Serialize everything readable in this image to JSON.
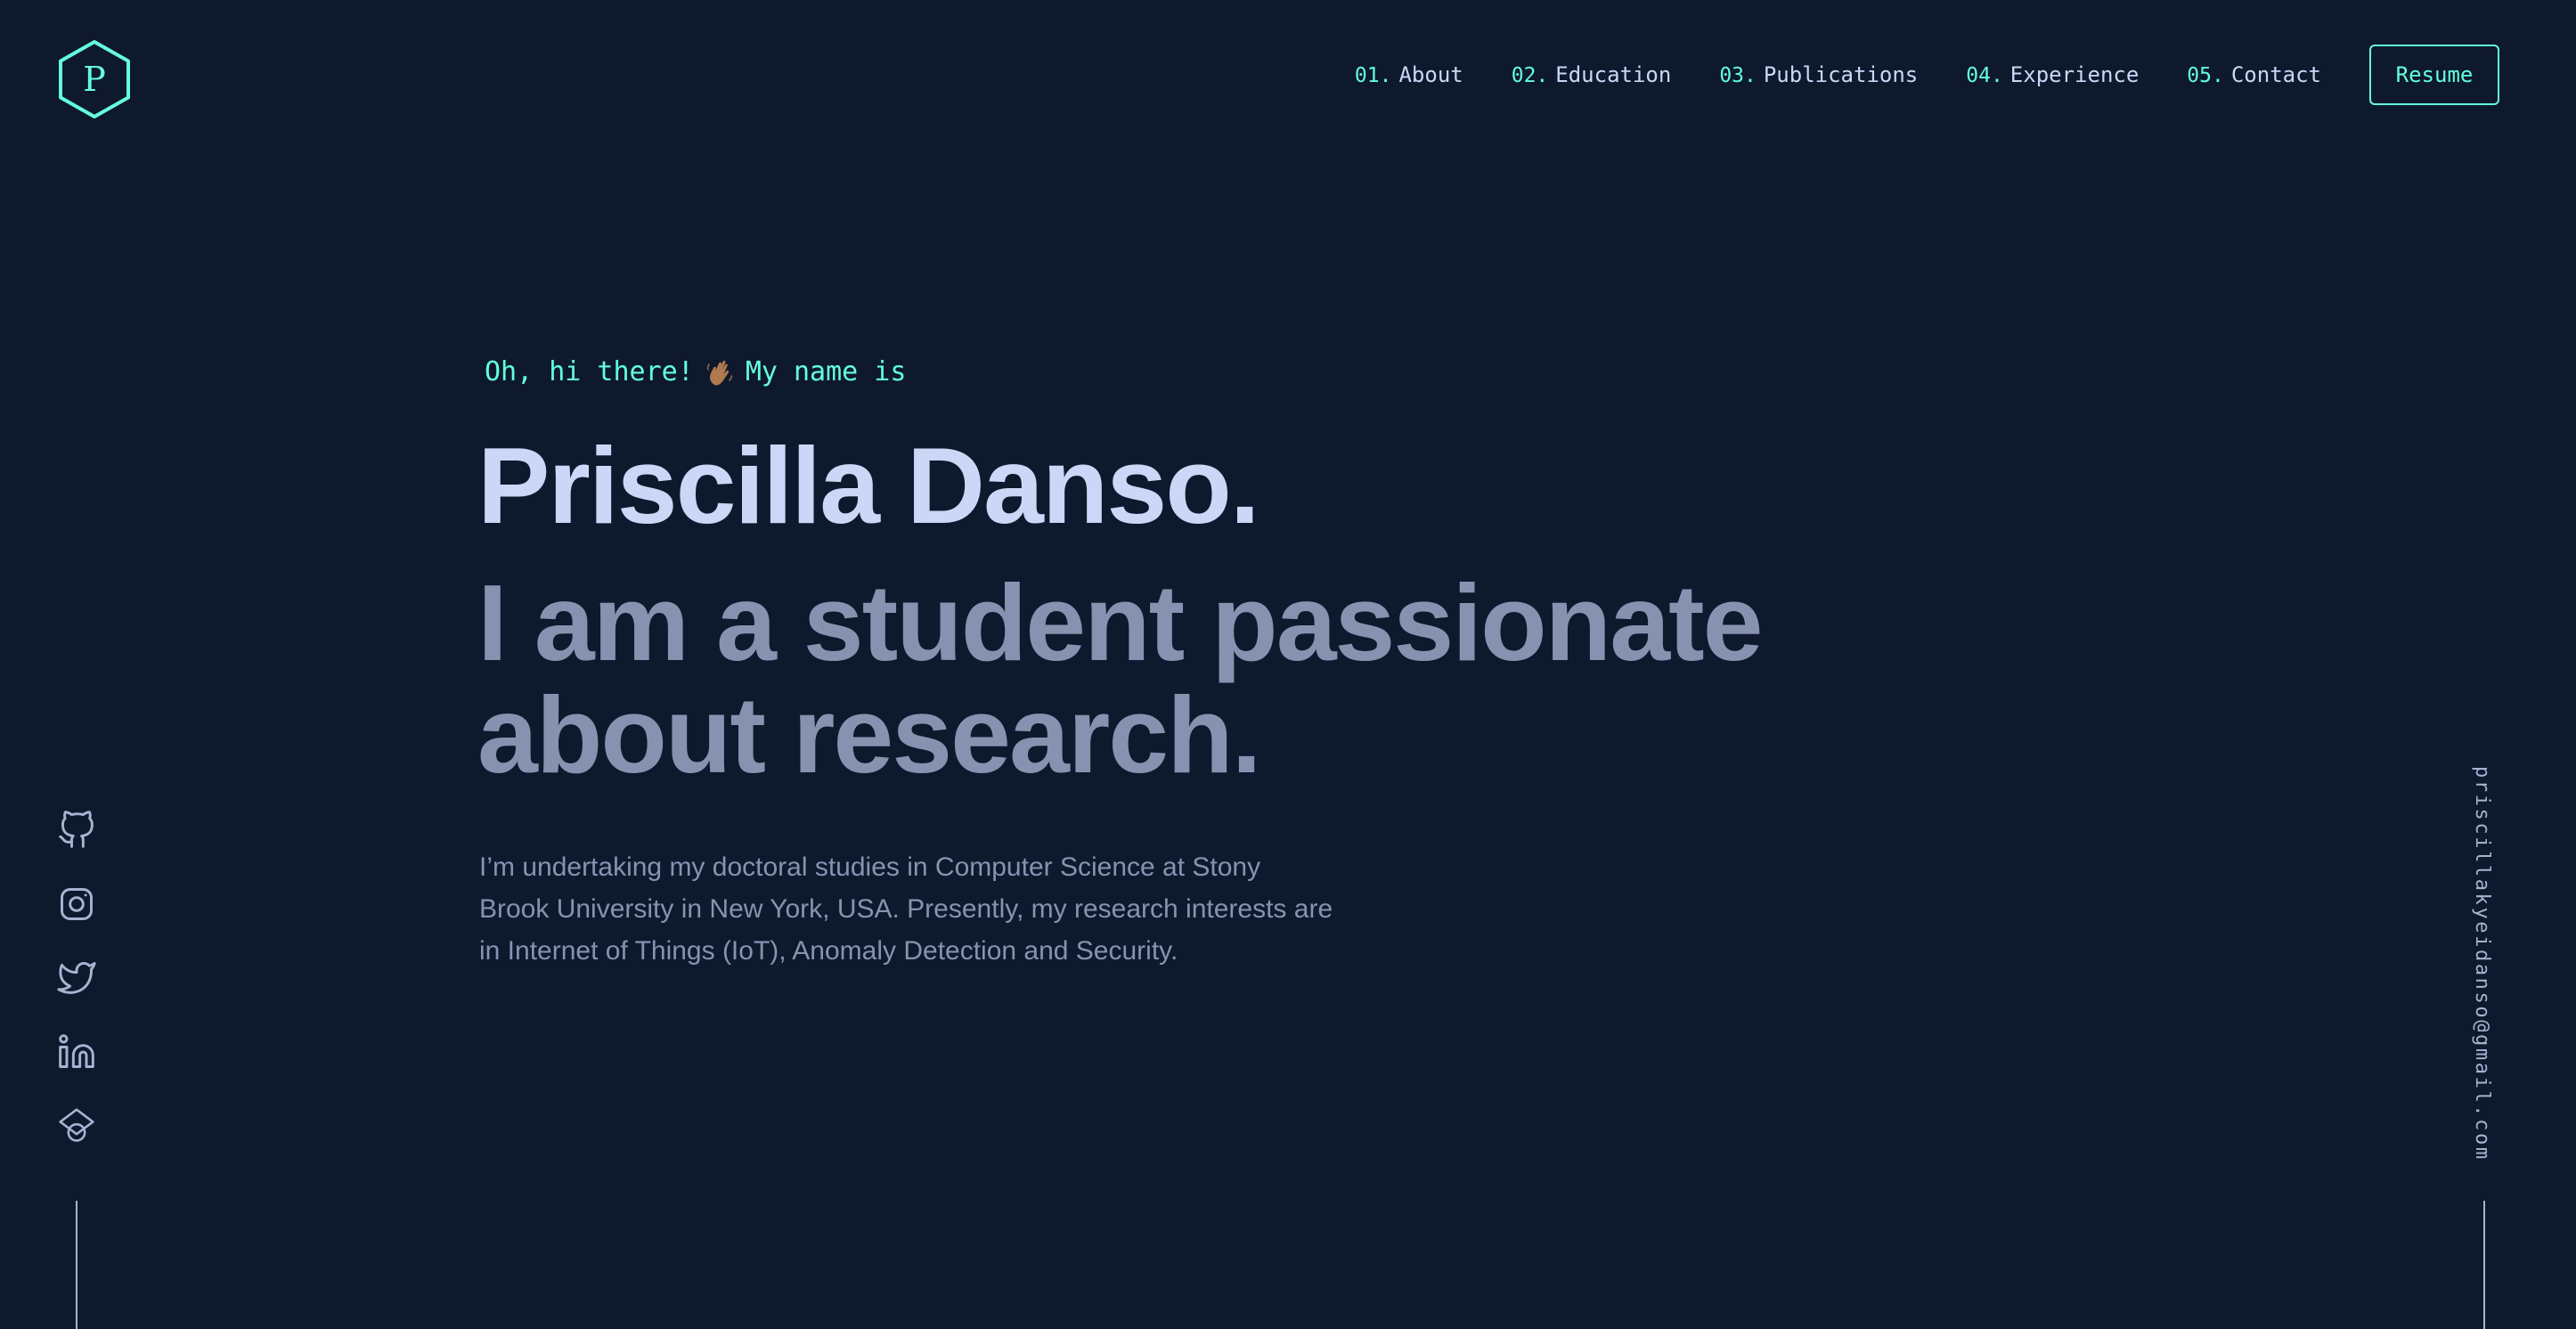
{
  "header": {
    "logo_letter": "P",
    "nav": [
      {
        "num": "01.",
        "label": "About"
      },
      {
        "num": "02.",
        "label": "Education"
      },
      {
        "num": "03.",
        "label": "Publications"
      },
      {
        "num": "04.",
        "label": "Experience"
      },
      {
        "num": "05.",
        "label": "Contact"
      }
    ],
    "resume_label": "Resume"
  },
  "hero": {
    "greeting_before": "Oh, hi there!",
    "greeting_after": "My name is",
    "name": "Priscilla Danso.",
    "tagline": "I am a student passionate about research.",
    "intro": "I’m undertaking my doctoral studies in Computer Science at Stony Brook University in New York, USA. Presently, my research interests are in Internet of Things (IoT), Anomaly Detection and Security."
  },
  "social": {
    "icons": [
      "github-icon",
      "instagram-icon",
      "twitter-icon",
      "linkedin-icon",
      "google-scholar-icon"
    ]
  },
  "email": "priscillakyeidanso@gmail.com",
  "colors": {
    "background": "#0e192e",
    "accent": "#64ffda",
    "heading": "#ccd6f6",
    "muted": "#8892b0",
    "light": "#a8b2d1"
  }
}
